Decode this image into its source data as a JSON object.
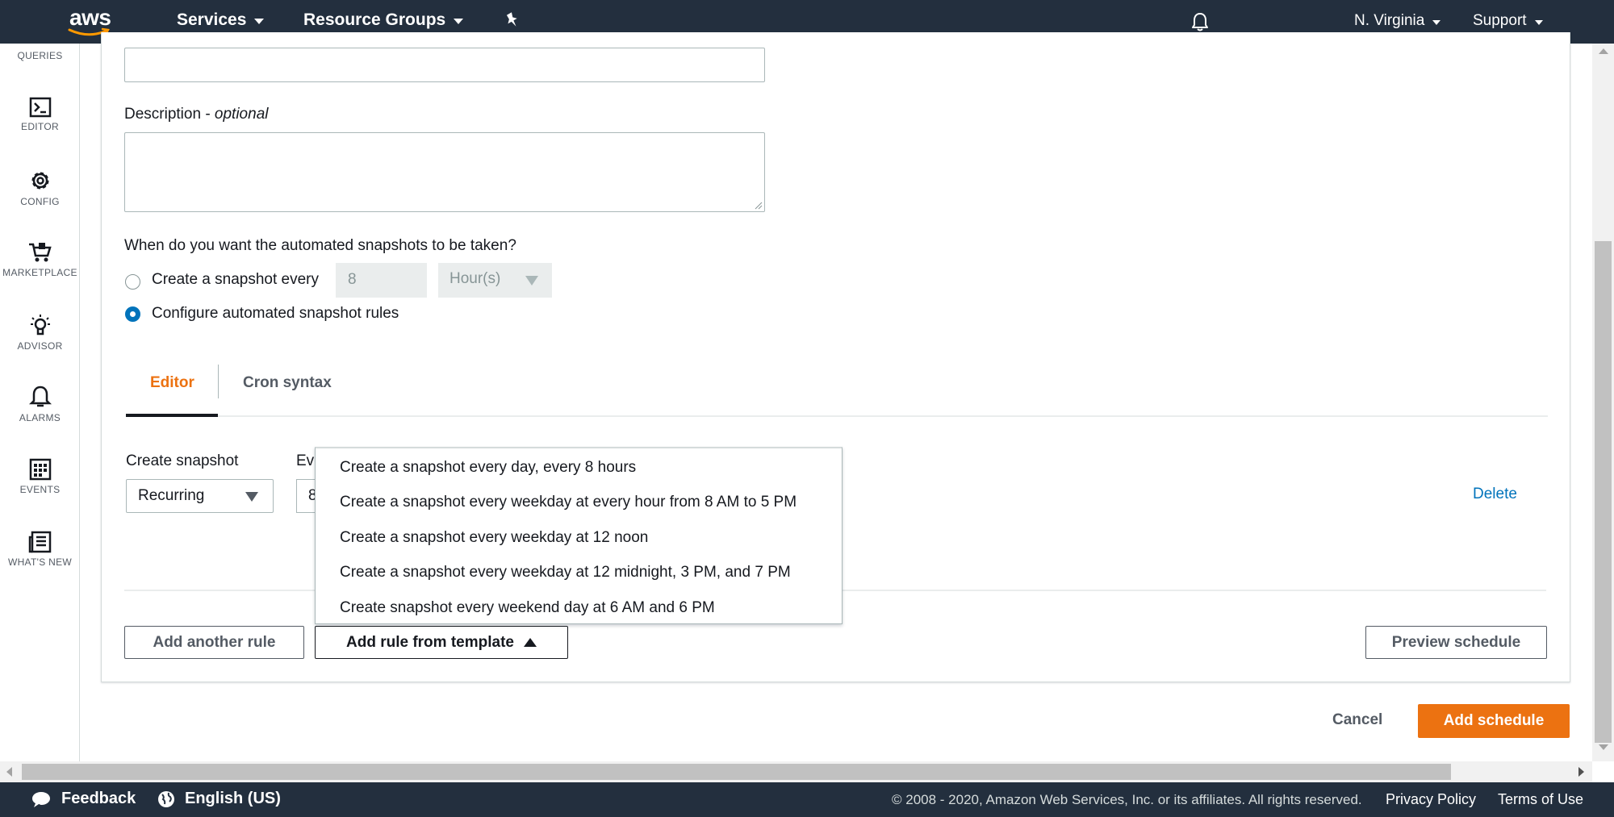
{
  "topnav": {
    "logo_text": "aws",
    "services": "Services",
    "resource_groups": "Resource Groups",
    "region": "N. Virginia",
    "support": "Support"
  },
  "siderail": {
    "queries": "QUERIES",
    "editor": "EDITOR",
    "config": "CONFIG",
    "marketplace": "MARKETPLACE",
    "advisor": "ADVISOR",
    "alarms": "ALARMS",
    "events": "EVENTS",
    "whats_new": "WHAT'S NEW"
  },
  "form": {
    "description_label": "Description - ",
    "description_optional": "optional",
    "snapshot_question": "When do you want the automated snapshots to be taken?",
    "radio_every_label": "Create a snapshot every",
    "radio_every_value": "8",
    "radio_every_unit": "Hour(s)",
    "radio_rules_label": "Configure automated snapshot rules"
  },
  "tabs": {
    "editor": "Editor",
    "cron": "Cron syntax"
  },
  "rule": {
    "create_snapshot_label": "Create snapshot",
    "every_label_partial": "Eve",
    "recurring_value": "Recurring",
    "every_value_partial": "8",
    "delete": "Delete"
  },
  "template_menu": {
    "items": [
      "Create a snapshot every day, every 8 hours",
      "Create a snapshot every weekday at every hour from 8 AM to 5 PM",
      "Create a snapshot every weekday at 12 noon",
      "Create a snapshot every weekday at 12 midnight, 3 PM, and 7 PM",
      "Create snapshot every weekend day at 6 AM and 6 PM"
    ]
  },
  "buttons": {
    "add_another_rule": "Add another rule",
    "add_rule_from_template": "Add rule from template",
    "preview_schedule": "Preview schedule",
    "cancel": "Cancel",
    "add_schedule": "Add schedule"
  },
  "footer": {
    "feedback": "Feedback",
    "language": "English (US)",
    "copyright": "© 2008 - 2020, Amazon Web Services, Inc. or its affiliates. All rights reserved.",
    "privacy": "Privacy Policy",
    "terms": "Terms of Use"
  },
  "colors": {
    "nav_bg": "#232f3e",
    "accent_orange": "#ec7211",
    "link_blue": "#0073bb"
  }
}
